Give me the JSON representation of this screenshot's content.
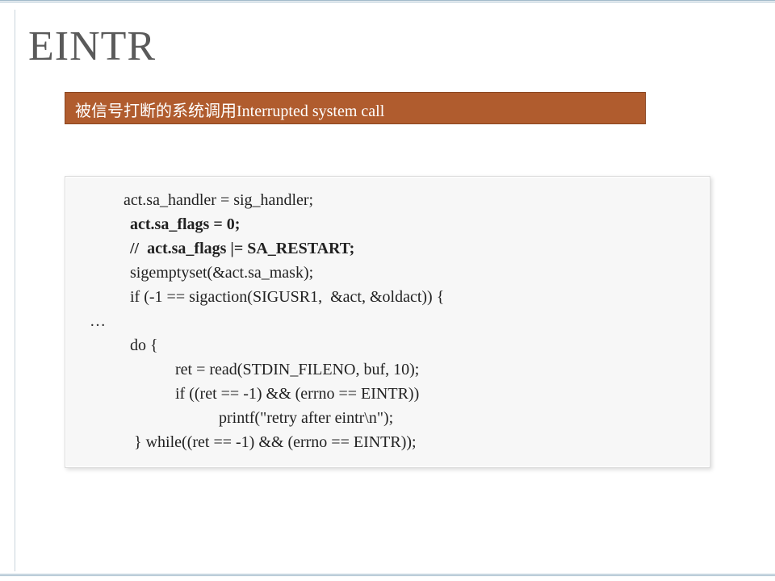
{
  "title": "EINTR",
  "banner": "被信号打断的系统调用Interrupted system call",
  "code": {
    "l1": "act.sa_handler = sig_handler;",
    "l2": "act.sa_flags = 0;",
    "l3": "//  act.sa_flags |= SA_RESTART;",
    "l4": "sigemptyset(&act.sa_mask);",
    "l5": "if (-1 == sigaction(SIGUSR1,  &act, &oldact)) {",
    "l6": "…",
    "l7": "do {",
    "l8": "ret = read(STDIN_FILENO, buf, 10);",
    "l9": "if ((ret == -1) && (errno == EINTR))",
    "l10": "printf(\"retry after eintr\\n\");",
    "l11": " } while((ret == -1) && (errno == EINTR));"
  }
}
